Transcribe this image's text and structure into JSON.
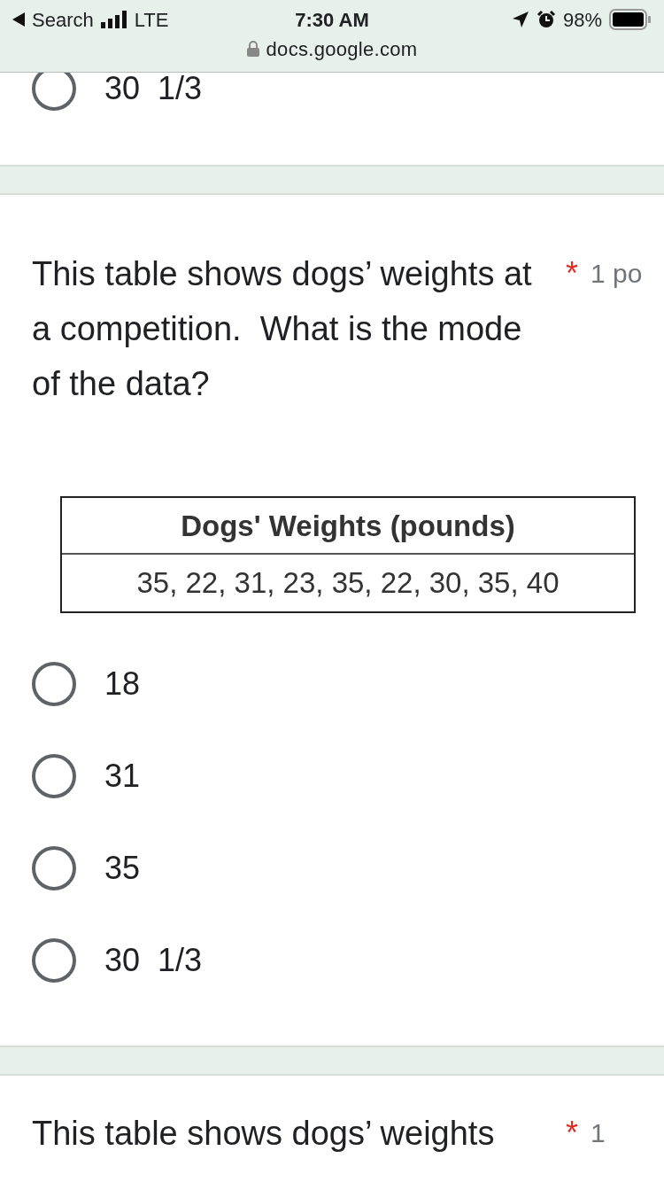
{
  "status_bar": {
    "back_label": "Search",
    "network": "LTE",
    "time": "7:30 AM",
    "battery": "98%",
    "url": "docs.google.com"
  },
  "previous_question": {
    "options": [
      {
        "label": "30  1/3",
        "selected": false
      }
    ]
  },
  "question": {
    "text": "This table shows dogs’ weights at a competition.  What is the mode of the data?",
    "required_mark": "*",
    "points": "1 po",
    "table": {
      "header": "Dogs' Weights (pounds)",
      "row": "35, 22, 31, 23, 35, 22, 30, 35, 40"
    },
    "options": [
      {
        "label": "18",
        "selected": false
      },
      {
        "label": "31",
        "selected": false
      },
      {
        "label": "35",
        "selected": false
      },
      {
        "label": "30  1/3",
        "selected": false
      }
    ]
  },
  "next_question": {
    "text": "This table shows dogs’ weights",
    "required_mark": "*",
    "points": "1"
  }
}
